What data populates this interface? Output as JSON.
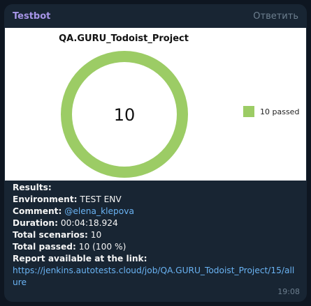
{
  "message": {
    "sender": "Testbot",
    "reply_label": "Ответить",
    "time": "19:08"
  },
  "chart_data": {
    "type": "pie",
    "title": "QA.GURU_Todoist_Project",
    "center_label": "10",
    "slices": [
      {
        "label": "10 passed",
        "value": 10,
        "color": "#9ccc65"
      }
    ],
    "legend_position": "right"
  },
  "results": {
    "heading": "Results:",
    "environment_label": "Environment:",
    "environment_value": " TEST ENV",
    "comment_label": "Comment:",
    "comment_value": "@elena_klepova",
    "duration_label": "Duration:",
    "duration_value": " 00:04:18.924",
    "total_scenarios_label": "Total scenarios:",
    "total_scenarios_value": " 10",
    "total_passed_label": "Total passed:",
    "total_passed_value": " 10 (100 %)",
    "report_label": "Report available at the link:",
    "report_link_line1": "https://jenkins.autotests.cloud/job/QA.GURU_Todoist_Project/15/all",
    "report_link_line2": "ure"
  }
}
